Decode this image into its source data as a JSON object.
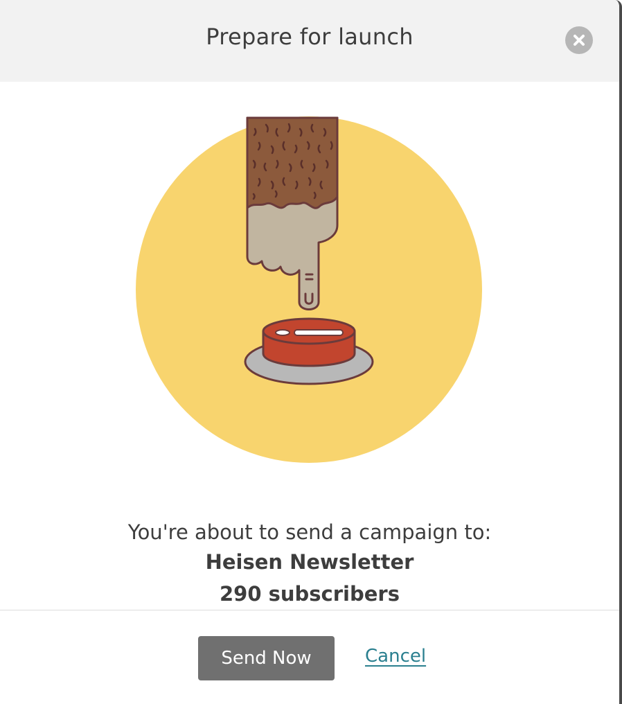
{
  "dialog": {
    "title": "Prepare for launch",
    "close_icon": "close-icon"
  },
  "illustration": {
    "icon": "finger-pressing-launch-button",
    "circle_color": "#f8d46e",
    "button_color": "#c2452e"
  },
  "message": {
    "intro": "You're about to send a campaign to:",
    "list_name": "Heisen Newsletter",
    "subscriber_count": "290 subscribers"
  },
  "actions": {
    "send_label": "Send Now",
    "cancel_label": "Cancel"
  }
}
